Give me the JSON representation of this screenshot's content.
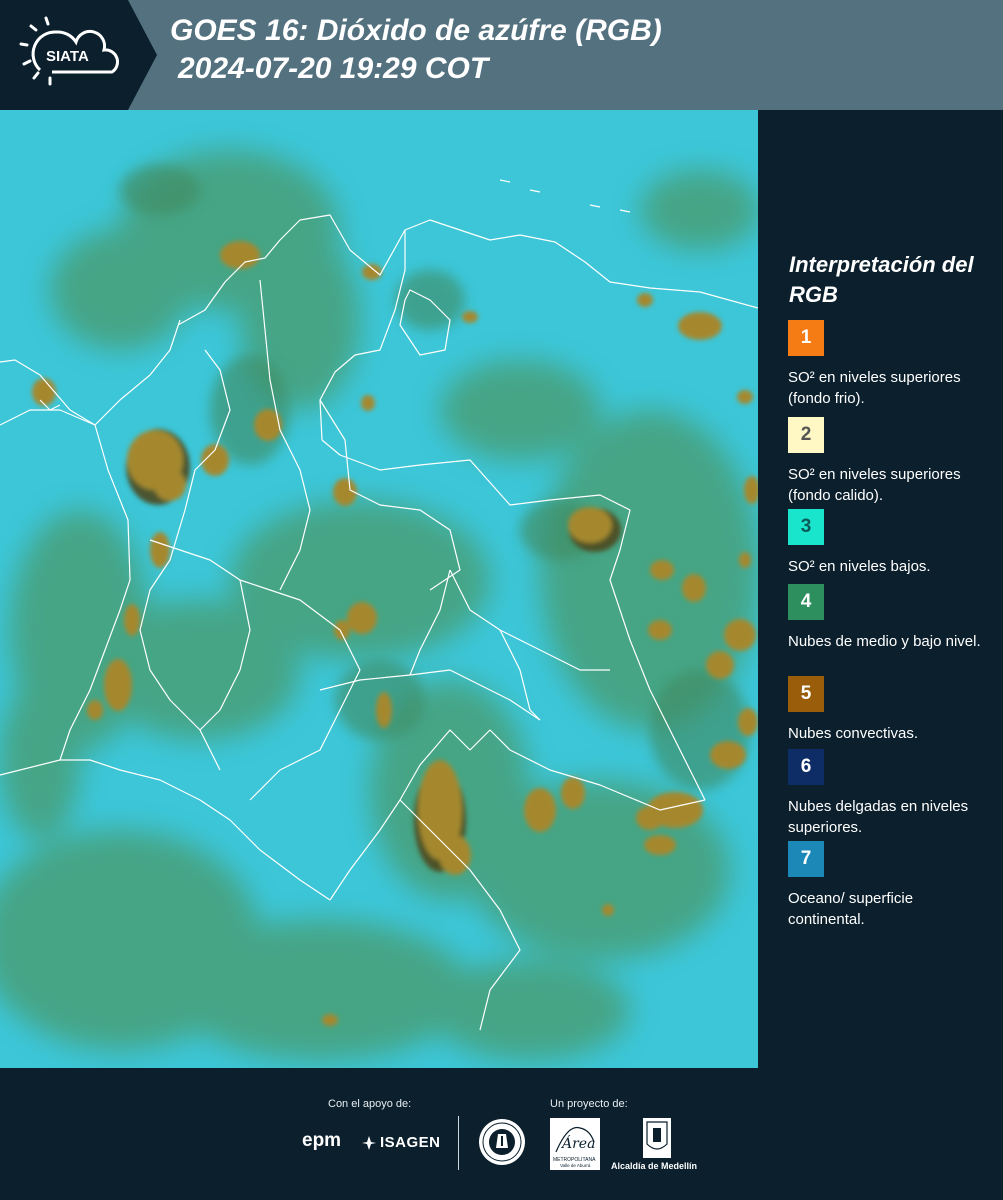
{
  "header": {
    "logo_text": "SIATA",
    "title_line1": "GOES 16: Dióxido de azúfre (RGB)",
    "title_line2": "2024-07-20 19:29 COT"
  },
  "legend": {
    "title": "Interpretación del RGB",
    "items": [
      {
        "number": "1",
        "color": "#f57c15",
        "label": "SO² en niveles superiores (fondo frio)."
      },
      {
        "number": "2",
        "color": "#fff8c4",
        "label": "SO² en niveles superiores (fondo calido)."
      },
      {
        "number": "3",
        "color": "#19e5cc",
        "label": "SO² en niveles bajos."
      },
      {
        "number": "4",
        "color": "#2e8f5e",
        "label": "Nubes de medio y bajo nivel."
      },
      {
        "number": "5",
        "color": "#9a5e0b",
        "label": "Nubes convectivas."
      },
      {
        "number": "6",
        "color": "#0e2d66",
        "label": "Nubes delgadas en niveles superiores."
      },
      {
        "number": "7",
        "color": "#1b88b8",
        "label": "Oceano/ superficie continental."
      }
    ]
  },
  "footer": {
    "support_label": "Con el apoyo de:",
    "project_label": "Un proyecto de:",
    "epm": "epm",
    "isagen": "ISAGEN",
    "area_metro": "Área",
    "area_metro_sub": "METROPOLITANA",
    "area_metro_sub2": "Valle de Aburrá",
    "alcaldia": "Alcaldía de Medellín"
  },
  "map": {
    "background_color": "#3cc6d8",
    "boundary_color": "#ffffff",
    "convective_color": "#9a7a2c",
    "midlevel_color": "#4f9a66"
  }
}
